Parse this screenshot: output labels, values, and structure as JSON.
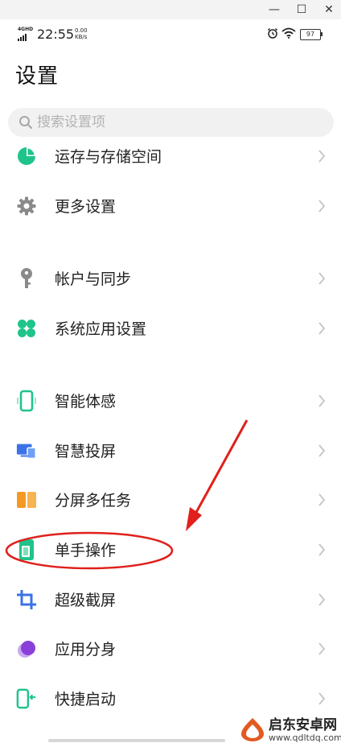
{
  "window_controls": {
    "minimize": "—",
    "maximize": "☐",
    "close": "✕"
  },
  "status_bar": {
    "network": "4GHD",
    "time": "22:55",
    "speed_value": "0.00",
    "speed_unit": "KB/s",
    "battery": "97"
  },
  "page": {
    "title": "设置"
  },
  "search": {
    "placeholder": "搜索设置项"
  },
  "items": [
    {
      "id": "storage",
      "label": "运存与存储空间",
      "icon": "pie-chart-icon",
      "color": "#1fc48a"
    },
    {
      "id": "more",
      "label": "更多设置",
      "icon": "gear-icon",
      "color": "#8a8a8a"
    },
    {
      "id": "account",
      "label": "帐户与同步",
      "icon": "key-icon",
      "color": "#8a8a8a"
    },
    {
      "id": "system-apps",
      "label": "系统应用设置",
      "icon": "clover-icon",
      "color": "#1fc48a"
    },
    {
      "id": "smart-motion",
      "label": "智能体感",
      "icon": "phone-outline-icon",
      "color": "#1fc48a"
    },
    {
      "id": "screen-cast",
      "label": "智慧投屏",
      "icon": "cast-screen-icon",
      "color": "#3b72e8"
    },
    {
      "id": "split-screen",
      "label": "分屏多任务",
      "icon": "split-screen-icon",
      "color": "#f39a24"
    },
    {
      "id": "one-hand",
      "label": "单手操作",
      "icon": "one-hand-phone-icon",
      "color": "#1fc48a"
    },
    {
      "id": "screenshot",
      "label": "超级截屏",
      "icon": "crop-icon",
      "color": "#3b72e8"
    },
    {
      "id": "app-clone",
      "label": "应用分身",
      "icon": "app-clone-icon",
      "color": "#8b3fd9"
    },
    {
      "id": "quick-launch",
      "label": "快捷启动",
      "icon": "quick-launch-icon",
      "color": "#1fc48a"
    }
  ],
  "watermark": {
    "name": "启东安卓网",
    "url": "www.qdltdq.com"
  },
  "colors": {
    "annotation": "#e0201c",
    "accent_green": "#1fc48a",
    "accent_blue": "#3b72e8"
  }
}
